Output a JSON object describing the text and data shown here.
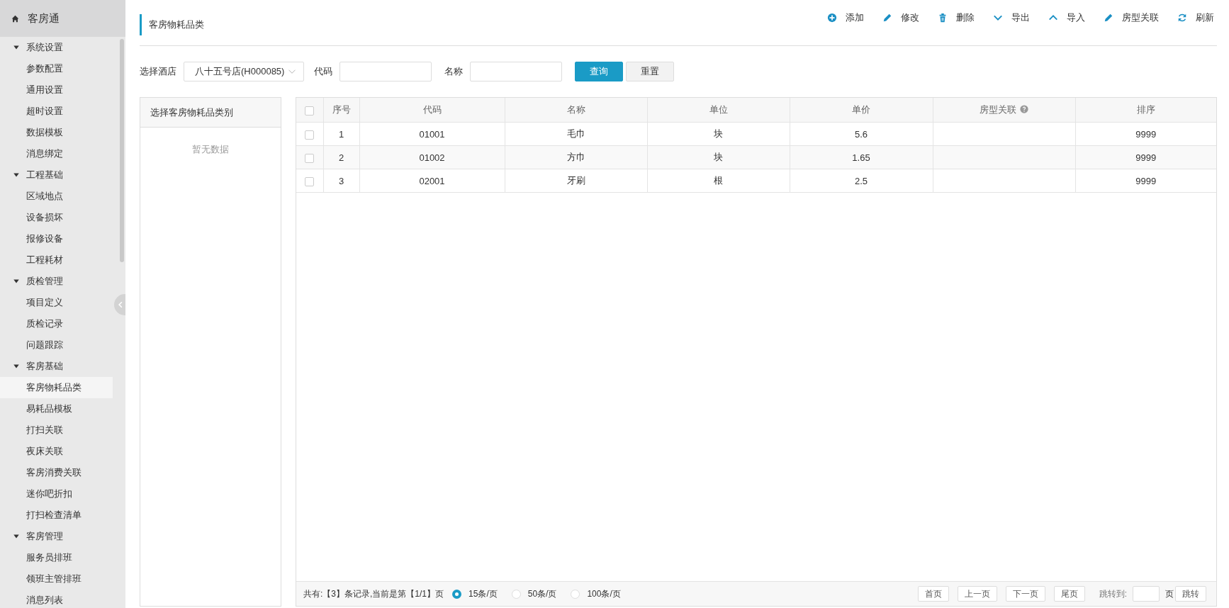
{
  "sidebar": {
    "title": "客房通",
    "groups": [
      {
        "label": "系统设置",
        "expanded": true,
        "items": [
          {
            "label": "参数配置",
            "selected": false
          },
          {
            "label": "通用设置",
            "selected": false
          },
          {
            "label": "超时设置",
            "selected": false
          },
          {
            "label": "数据模板",
            "selected": false
          },
          {
            "label": "消息绑定",
            "selected": false
          }
        ]
      },
      {
        "label": "工程基础",
        "expanded": true,
        "items": [
          {
            "label": "区域地点",
            "selected": false
          },
          {
            "label": "设备损坏",
            "selected": false
          },
          {
            "label": "报修设备",
            "selected": false
          },
          {
            "label": "工程耗材",
            "selected": false
          }
        ]
      },
      {
        "label": "质检管理",
        "expanded": true,
        "items": [
          {
            "label": "项目定义",
            "selected": false
          },
          {
            "label": "质检记录",
            "selected": false
          },
          {
            "label": "问题跟踪",
            "selected": false
          }
        ]
      },
      {
        "label": "客房基础",
        "expanded": true,
        "items": [
          {
            "label": "客房物耗品类",
            "selected": true
          },
          {
            "label": "易耗品模板",
            "selected": false
          },
          {
            "label": "打扫关联",
            "selected": false
          },
          {
            "label": "夜床关联",
            "selected": false
          },
          {
            "label": "客房消费关联",
            "selected": false
          },
          {
            "label": "迷你吧折扣",
            "selected": false
          },
          {
            "label": "打扫检查清单",
            "selected": false
          }
        ]
      },
      {
        "label": "客房管理",
        "expanded": true,
        "items": [
          {
            "label": "服务员排班",
            "selected": false
          },
          {
            "label": "领班主管排班",
            "selected": false
          },
          {
            "label": "消息列表",
            "selected": false
          }
        ]
      }
    ]
  },
  "page_title": "客房物耗品类",
  "toolbar": [
    {
      "kind": "add",
      "label": "添加"
    },
    {
      "kind": "edit",
      "label": "修改"
    },
    {
      "kind": "delete",
      "label": "删除"
    },
    {
      "kind": "export",
      "label": "导出"
    },
    {
      "kind": "import",
      "label": "导入"
    },
    {
      "kind": "edit",
      "label": "房型关联"
    },
    {
      "kind": "refresh",
      "label": "刷新"
    }
  ],
  "filters": {
    "hotel_label": "选择酒店",
    "hotel_value": "八十五号店(H000085)",
    "code_label": "代码",
    "name_label": "名称",
    "search_button": "查询",
    "reset_button": "重置"
  },
  "category_panel": {
    "title": "选择客房物耗品类别",
    "empty_text": "暂无数据"
  },
  "table": {
    "all_checked": false,
    "columns": [
      {
        "label": "序号",
        "help": false
      },
      {
        "label": "代码",
        "help": false
      },
      {
        "label": "名称",
        "help": false
      },
      {
        "label": "单位",
        "help": false
      },
      {
        "label": "单价",
        "help": false
      },
      {
        "label": "房型关联",
        "help": true
      },
      {
        "label": "排序",
        "help": false
      }
    ],
    "rows": [
      {
        "checked": false,
        "cells": [
          "1",
          "01001",
          "毛巾",
          "块",
          "5.6",
          "",
          "9999"
        ]
      },
      {
        "checked": false,
        "cells": [
          "2",
          "01002",
          "方巾",
          "块",
          "1.65",
          "",
          "9999"
        ]
      },
      {
        "checked": false,
        "cells": [
          "3",
          "02001",
          "牙刷",
          "根",
          "2.5",
          "",
          "9999"
        ]
      }
    ]
  },
  "pager": {
    "summary": "共有:【3】条记录,当前是第【1/1】页",
    "page_sizes": [
      {
        "label": "15条/页",
        "selected": true
      },
      {
        "label": "50条/页",
        "selected": false
      },
      {
        "label": "100条/页",
        "selected": false
      }
    ],
    "buttons": [
      "首页",
      "上一页",
      "下一页",
      "尾页"
    ],
    "jump_label": "跳转到:",
    "page_unit": "页",
    "jump_button": "跳转"
  }
}
